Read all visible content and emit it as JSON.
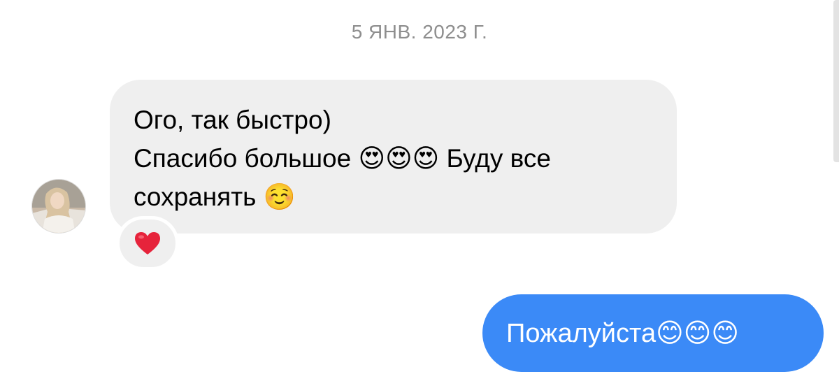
{
  "conversation": {
    "date_divider": "5 ЯНВ. 2023 Г.",
    "incoming": {
      "avatar_icon": "user-avatar-photo",
      "lines": [
        "Ого, так быстро)",
        "Спасибо большое 😍😍😍 Буду все",
        "сохранять ☺️"
      ],
      "reaction": {
        "emoji": "❤️",
        "icon": "red-heart-icon",
        "color": "#e6233b"
      },
      "bubble_color": "#efefef"
    },
    "outgoing": {
      "text": "Пожалуйста😊😊😊",
      "bubble_color": "#3b8af7"
    }
  }
}
